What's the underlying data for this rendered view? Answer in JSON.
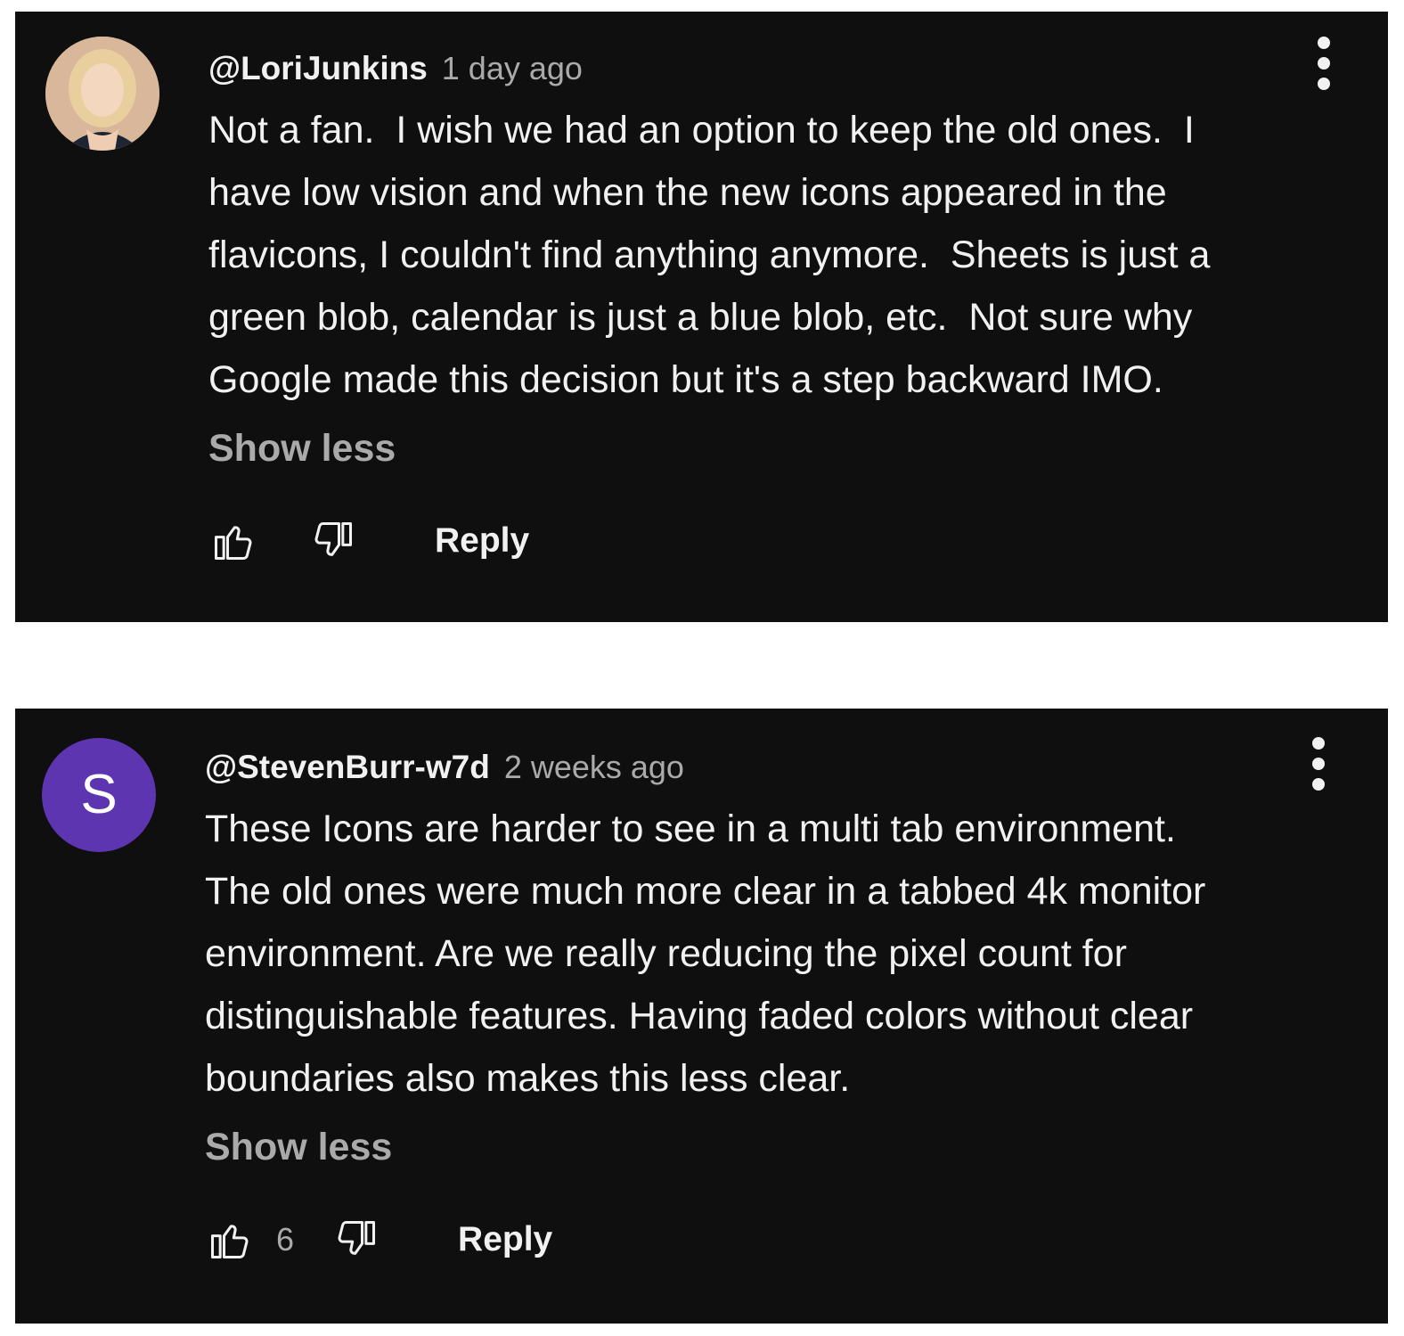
{
  "comments": [
    {
      "author": "@LoriJunkins",
      "time": "1 day ago",
      "avatar_letter": "",
      "avatar_color": "#e6c7a6",
      "text": "Not a fan.  I wish we had an option to keep the old ones.  I\nhave low vision and when the new icons appeared in the\nflavicons, I couldn't find anything anymore.  Sheets is just a\ngreen blob, calendar is just a blue blob, etc.  Not sure why\nGoogle made this decision but it's a step backward IMO.",
      "show_less": "Show less",
      "like_count": "",
      "reply": "Reply"
    },
    {
      "author": "@StevenBurr-w7d",
      "time": "2 weeks ago",
      "avatar_letter": "S",
      "avatar_color": "#5e35b1",
      "text": "These Icons are harder to see in a multi tab environment.\nThe old ones were much more clear in a tabbed 4k monitor\nenvironment. Are we really reducing the pixel count for\ndistinguishable features. Having faded colors without clear\nboundaries also makes this less clear.",
      "show_less": "Show less",
      "like_count": "6",
      "reply": "Reply"
    }
  ],
  "icons": {
    "like": "thumb-up-icon",
    "dislike": "thumb-down-icon",
    "more": "more-vert-icon"
  },
  "colors": {
    "background": "#0f0f0f",
    "text": "#f1f1f1",
    "secondary_text": "#aaaaaa"
  }
}
